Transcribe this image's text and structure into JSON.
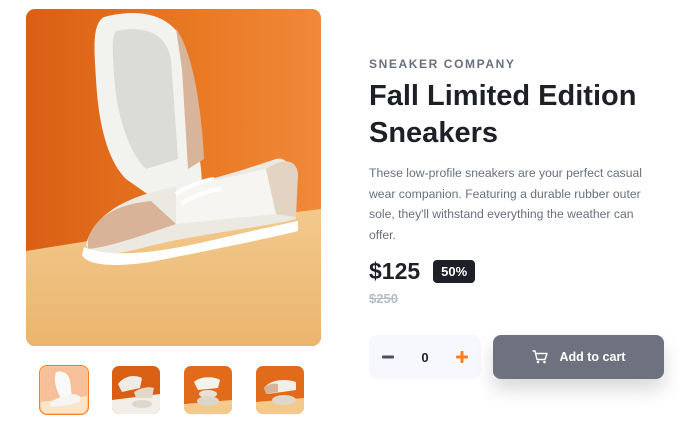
{
  "product": {
    "company": "SNEAKER COMPANY",
    "title": "Fall Limited Edition Sneakers",
    "description": "These low-profile sneakers are your perfect casual wear companion. Featuring a durable rubber outer sole, they'll withstand everything the weather can offer.",
    "price": "$125",
    "discount": "50%",
    "original_price": "$250"
  },
  "cart": {
    "quantity": "0",
    "minus_icon": "minus-icon",
    "plus_icon": "plus-icon",
    "add_label": "Add to cart",
    "cart_icon": "cart-icon"
  },
  "gallery": {
    "thumbnails": [
      "product-1",
      "product-2",
      "product-3",
      "product-4"
    ],
    "active_index": 0
  },
  "colors": {
    "accent": "#ff7e1b",
    "dark": "#1d2026",
    "button": "#6e727f",
    "image_bg": "#e8741f",
    "floor": "#f2c88a"
  }
}
